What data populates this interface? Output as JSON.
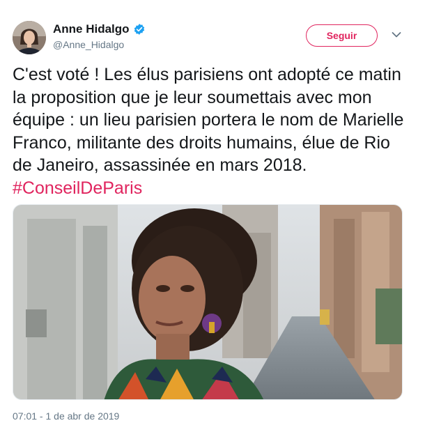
{
  "user": {
    "display_name": "Anne Hidalgo",
    "handle": "@Anne_Hidalgo",
    "verified": true
  },
  "follow_button": {
    "label": "Seguir"
  },
  "tweet": {
    "text": "C'est voté ! Les élus parisiens ont adopté ce matin la proposition que je leur soumettais avec mon équipe : un lieu parisien portera le nom de Marielle Franco, militante des droits humains, élue de Rio de Janeiro, assassinée en mars 2018.",
    "hashtag": "#ConseilDeParis",
    "timestamp": "07:01 - 1 de abr de 2019"
  },
  "icons": {
    "verified": "verified-badge-icon",
    "caret": "chevron-down-icon"
  },
  "colors": {
    "accent": "#e0245e",
    "verified_blue": "#1da1f2",
    "secondary_text": "#657786",
    "primary_text": "#14171a"
  }
}
